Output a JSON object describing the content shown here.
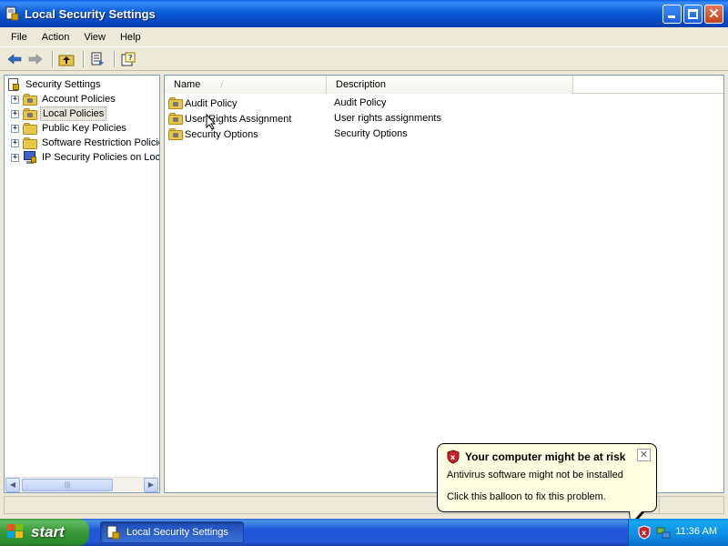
{
  "window": {
    "title": "Local Security Settings"
  },
  "menu": [
    "File",
    "Action",
    "View",
    "Help"
  ],
  "tree": {
    "root": "Security Settings",
    "items": [
      {
        "label": "Account Policies",
        "icon": "locked-folder-icon",
        "expander": "+"
      },
      {
        "label": "Local Policies",
        "icon": "locked-folder-icon",
        "expander": "+",
        "selected": true
      },
      {
        "label": "Public Key Policies",
        "icon": "folder-icon",
        "expander": "+"
      },
      {
        "label": "Software Restriction Policies",
        "icon": "folder-icon",
        "expander": "+"
      },
      {
        "label": "IP Security Policies on Local Computer",
        "icon": "ip-security-icon",
        "expander": "+"
      }
    ]
  },
  "list": {
    "columns": {
      "name": "Name",
      "sort_indicator": "/",
      "description": "Description"
    },
    "rows": [
      {
        "name": "Audit Policy",
        "description": "Audit Policy"
      },
      {
        "name": "User Rights Assignment",
        "description": "User rights assignments"
      },
      {
        "name": "Security Options",
        "description": "Security Options"
      }
    ]
  },
  "taskbar": {
    "start_label": "start",
    "task_button": "Local Security Settings",
    "clock": "11:36 AM"
  },
  "balloon": {
    "title": "Your computer might be at risk",
    "line1": "Antivirus software might not be installed",
    "line2": "Click this balloon to fix this problem.",
    "close": "✕"
  },
  "colors": {
    "titlebar": "#0842B8",
    "taskbar": "#2157D7",
    "start": "#379A37",
    "balloon": "#FFFFE1"
  }
}
